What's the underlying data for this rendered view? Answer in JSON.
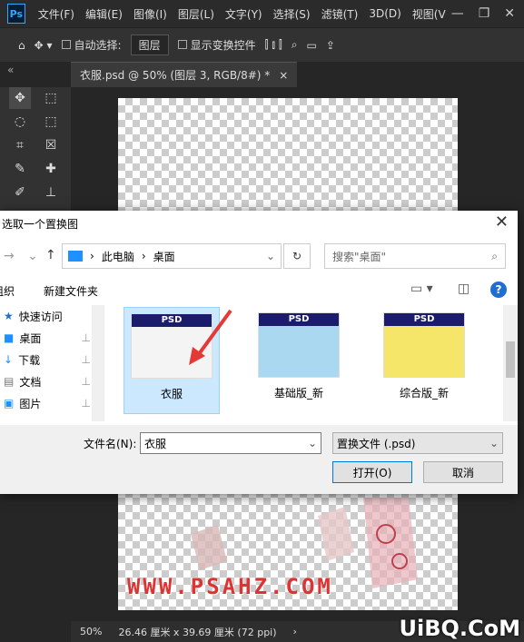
{
  "menubar": {
    "logo": "Ps",
    "items": [
      "文件(F)",
      "编辑(E)",
      "图像(I)",
      "图层(L)",
      "文字(Y)",
      "选择(S)",
      "滤镜(T)",
      "3D(D)",
      "视图(V"
    ],
    "controls": [
      "—",
      "❐",
      "✕"
    ]
  },
  "optbar": {
    "auto_select_label": "自动选择:",
    "auto_select_value": "图层",
    "show_transform_label": "显示变换控件"
  },
  "doc_tab": {
    "title": "衣服.psd @ 50% (图层 3, RGB/8#) *",
    "close": "×"
  },
  "canvas": {
    "watermark": "WWW.PSAHZ.COM"
  },
  "statusbar": {
    "zoom": "50%",
    "info": "26.46 厘米 x 39.69 厘米 (72 ppi)",
    "arrow": "›"
  },
  "site_watermark": "UiBQ.CoM",
  "dialog": {
    "title": "选取一个置换图",
    "close": "✕",
    "address": {
      "pc": "此电脑",
      "sep": "›",
      "folder": "桌面"
    },
    "search_placeholder": "搜索\"桌面\"",
    "new_folder": "新建文件夹",
    "organize": "组织",
    "sidebar": [
      {
        "label": "快速访问",
        "icon": "star-icon"
      },
      {
        "label": "桌面",
        "icon": "desktop-icon"
      },
      {
        "label": "下载",
        "icon": "download-icon"
      },
      {
        "label": "文档",
        "icon": "document-icon"
      },
      {
        "label": "图片",
        "icon": "picture-icon"
      }
    ],
    "files": [
      {
        "name": "衣服",
        "badge": "PSD",
        "selected": true
      },
      {
        "name": "基础版_新",
        "badge": "PSD",
        "selected": false
      },
      {
        "name": "综合版_新",
        "badge": "PSD",
        "selected": false
      }
    ],
    "filename_label": "文件名(N):",
    "filename_value": "衣服",
    "filetype_value": "置换文件 (.psd)",
    "open_button": "打开(O)",
    "cancel_button": "取消"
  }
}
